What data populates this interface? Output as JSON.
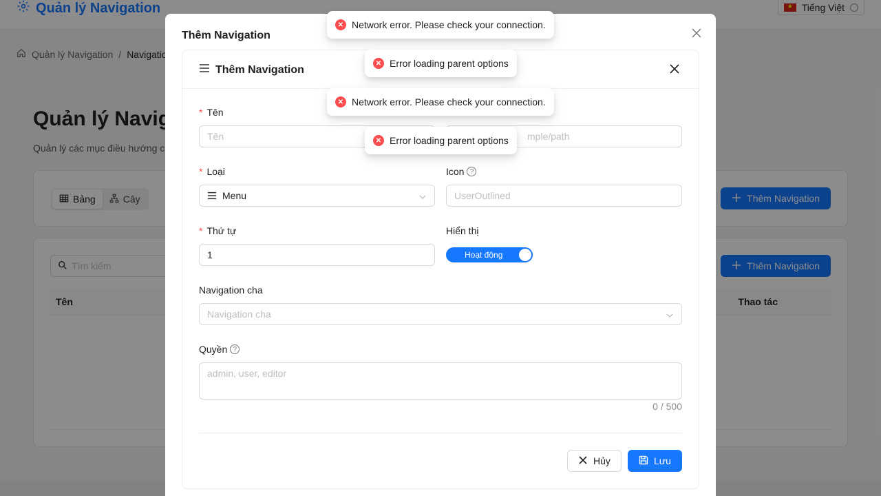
{
  "header": {
    "brand_title": "Quản lý Navigation",
    "language": "Tiếng Việt"
  },
  "breadcrumb": {
    "root": "Quản lý Navigation",
    "separator": "/",
    "current": "Navigation"
  },
  "page": {
    "title": "Quản lý Navigation",
    "description": "Quản lý các mục điều hướng c"
  },
  "view_switch": {
    "table_label": "Bảng",
    "tree_label": "Cây"
  },
  "toolbar": {
    "add_button_label": "Thêm Navigation"
  },
  "table": {
    "search_placeholder": "Tìm kiếm",
    "add_button_label": "Thêm Navigation",
    "columns": [
      "Tên",
      "Thao tác"
    ]
  },
  "modal": {
    "title": "Thêm Navigation"
  },
  "form": {
    "title": "Thêm Navigation",
    "name_label": "Tên",
    "name_placeholder": "Tên",
    "path_placeholder": "mple/path",
    "type_label": "Loại",
    "type_value": "Menu",
    "icon_label": "Icon",
    "icon_placeholder": "UserOutlined",
    "order_label": "Thứ tự",
    "order_value": "1",
    "visible_label": "Hiển thị",
    "visible_toggle_text": "Hoạt động",
    "visible_on": true,
    "parent_label": "Navigation cha",
    "parent_placeholder": "Navigation cha",
    "permissions_label": "Quyền",
    "permissions_placeholder": "admin, user, editor",
    "permissions_counter": "0 / 500",
    "cancel_label": "Hủy",
    "save_label": "Lưu"
  },
  "toasts": [
    {
      "message": "Network error. Please check your connection."
    },
    {
      "message": "Error loading parent options"
    },
    {
      "message": "Network error. Please check your connection."
    },
    {
      "message": "Error loading parent options"
    }
  ],
  "colors": {
    "primary": "#1677ff",
    "error": "#ff4d4f"
  }
}
